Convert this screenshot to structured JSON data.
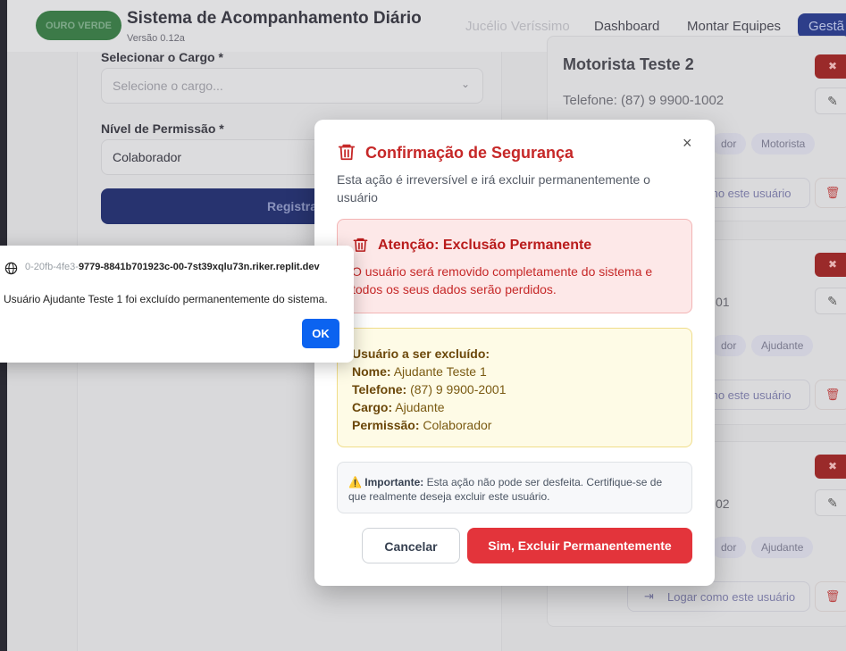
{
  "app": {
    "brand": "OURO VERDE",
    "title": "Sistema de Acompanhamento Diário",
    "version": "Versão 0.12a",
    "user": "Jucélio Veríssimo",
    "nav": [
      "Dashboard",
      "Montar Equipes"
    ],
    "nav_button": "Gestã"
  },
  "form": {
    "cargo_label": "Selecionar o Cargo *",
    "cargo_placeholder": "Selecione o cargo...",
    "permission_label": "Nível de Permissão *",
    "permission_value": "Colaborador",
    "submit_label": "Registra"
  },
  "user_cards": [
    {
      "name": "Motorista Teste 2",
      "phone": "Telefone: (87) 9 9900-1002",
      "badge1": "dor",
      "badge2": "Motorista",
      "login": "mo este usuário"
    },
    {
      "name": "",
      "phone": "01",
      "badge1": "dor",
      "badge2": "Ajudante",
      "login": "mo este usuário"
    },
    {
      "name": "",
      "phone": "02",
      "badge1": "dor",
      "badge2": "Ajudante",
      "login": "Logar como este usuário"
    }
  ],
  "modal": {
    "title": "Confirmação de Segurança",
    "description": "Esta ação é irreversível e irá excluir permanentemente o usuário",
    "warning_title": "Atenção: Exclusão Permanente",
    "warning_text": "O usuário será removido completamente do sistema e todos os seus dados serão perdidos.",
    "info_heading": "Usuário a ser excluído:",
    "name_label": "Nome:",
    "name_value": "Ajudante Teste 1",
    "phone_label": "Telefone:",
    "phone_value": "(87) 9 9900-2001",
    "role_label": "Cargo:",
    "role_value": "Ajudante",
    "perm_label": "Permissão:",
    "perm_value": "Colaborador",
    "note_icon": "⚠️",
    "note_bold": "Importante:",
    "note_text": "Esta ação não pode ser desfeita. Certifique-se de que realmente deseja excluir este usuário.",
    "cancel_label": "Cancelar",
    "confirm_label": "Sim, Excluir Permanentemente",
    "close_glyph": "×"
  },
  "alert": {
    "origin_faded": "0-20fb-4fe3-",
    "origin": "9779-8841b701923c-00-7st39xqlu73n.riker.replit.dev",
    "message": "Usuário Ajudante Teste 1 foi excluído permanentemente do sistema.",
    "ok_label": "OK"
  },
  "colors": {
    "danger": "#c62828",
    "confirm": "#e3343b",
    "alert_ok": "#0b63f0"
  }
}
